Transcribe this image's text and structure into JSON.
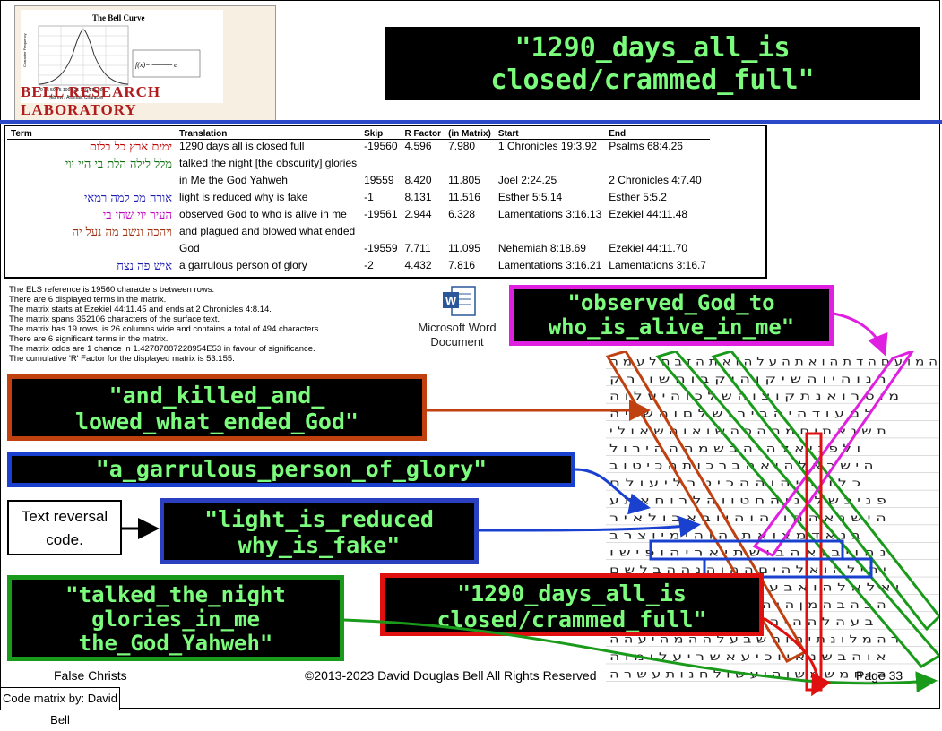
{
  "logo": {
    "chart_title": "The Bell Curve",
    "y_ticks": [
      "60",
      "50",
      "40",
      "30",
      "20",
      "10",
      "0"
    ],
    "x_ticks": "0  25  50  75  100  125  150  175  200",
    "x_label": "Hebrew / Aramaic Character",
    "y_label": "Character Frequency",
    "lab_name": "BELL RESEARCH LABORATORY"
  },
  "title": {
    "line1": "\"1290_days_all_is",
    "line2": "closed/crammed_full\""
  },
  "table": {
    "headers": [
      "Term",
      "Translation",
      "Skip",
      "R Factor",
      "(in Matrix)",
      "Start",
      "End"
    ],
    "rows": [
      {
        "term": "ימים ארץ כל בלום",
        "color": "#c00000",
        "translation": "1290 days all is closed full",
        "skip": "-19560",
        "r": "4.596",
        "m": "7.980",
        "start": "1 Chronicles 19:3.92",
        "end": "Psalms 68:4.26"
      },
      {
        "term": "מלל לילה הלת בי היי יוי",
        "color": "#107010",
        "translation": "talked the night [the obscurity] glories",
        "skip": "",
        "r": "",
        "m": "",
        "start": "",
        "end": ""
      },
      {
        "term": "",
        "color": "#000000",
        "translation": "in Me the God Yahweh",
        "skip": "19559",
        "r": "8.420",
        "m": "11.805",
        "start": "Joel 2:24.25",
        "end": "2 Chronicles 4:7.40"
      },
      {
        "term": "אורה מכ למה רמאי",
        "color": "#1a1ab0",
        "translation": "light is reduced why is fake",
        "skip": "-1",
        "r": "8.131",
        "m": "11.516",
        "start": "Esther 5:5.14",
        "end": "Esther 5:5.2"
      },
      {
        "term": "העיר יוי שחי בי",
        "color": "#c000c0",
        "translation": "observed God to who is alive in me",
        "skip": "-19561",
        "r": "2.944",
        "m": "6.328",
        "start": "Lamentations 3:16.13",
        "end": "Ezekiel 44:11.48"
      },
      {
        "term": "ויהכה ונשב מה נעל יה",
        "color": "#a03010",
        "translation": "and plagued and blowed what ended",
        "skip": "",
        "r": "",
        "m": "",
        "start": "",
        "end": ""
      },
      {
        "term": "",
        "color": "#000000",
        "translation": "God",
        "skip": "-19559",
        "r": "7.711",
        "m": "11.095",
        "start": "Nehemiah 8:18.69",
        "end": "Ezekiel 44:11.70"
      },
      {
        "term": "איש פה נצח",
        "color": "#1a1ab0",
        "translation": "a garrulous person of glory",
        "skip": "-2",
        "r": "4.432",
        "m": "7.816",
        "start": "Lamentations 3:16.21",
        "end": "Lamentations 3:16.7"
      }
    ]
  },
  "notes": [
    "The ELS reference is 19560 characters between rows.",
    "There are 6 displayed terms in the matrix.",
    "The matrix starts at Ezekiel 44:11.45 and ends at 2 Chronicles 4:8.14.",
    "The matrix spans 352106 characters of the surface text.",
    "The matrix has 19 rows, is 26 columns wide and contains a total of 494 characters.",
    "There are 6 significant terms in the matrix.",
    "The matrix odds are 1 chance in 1.42787887228954E53  in favour of significance.",
    "The cumulative 'R' Factor for the displayed matrix is 53.155."
  ],
  "word_doc": {
    "icon_letter": "W",
    "label": "Microsoft Word Document"
  },
  "labels": {
    "observed": {
      "text": "\"observed_God_to\nwho_is_alive_in_me\"",
      "color": "#e020e0"
    },
    "killed": {
      "text": "\"and_killed_and_\nlowed_what_ended_God\"",
      "color": "#c04010"
    },
    "garrulous": {
      "text": "\"a_garrulous_person_of_glory\"",
      "color": "#1a40d0"
    },
    "light": {
      "text": "\"light_is_reduced\nwhy_is_fake\"",
      "color": "#2a40c0"
    },
    "talked": {
      "text": "\"talked_the_night\nglories_in_me\nthe_God_Yahweh\"",
      "color": "#1a9a1a"
    },
    "days": {
      "text": "\"1290_days_all_is\nclosed/crammed_full\"",
      "color": "#e01010"
    }
  },
  "text_reversal": "Text reversal code.",
  "matrix_rows": [
    "ה מ ו ע ם ה ד ת ה ו א ת ה ע ל ה ו א ת ה ז ב ח ל ע מ ה",
    "ר נ ו ה י ו ה ש י ק ו ה י ק ב ו ה ש ו י ר ק",
    "מ ו ס ר ו א נ ת ק ו צ ו ה ש ל כ ו ה י ע ל ו ה",
    "ל ם ע ו ד ה י ה ב י ר ו ש ל ם ו ה ש ו י ה",
    "ת ש נ א ת י ם מ ה ה כ ה ש ו א ו ה ש א ו ל י",
    "ו ל פ נ י א ל ה י ה ב ש מ ה ה ה י ר ו ל",
    "ה י ש ר א ל ה ו א ה ב ר כ ו ת ה כ י ט ו ב",
    "כ ל ו י ה י ה ו ה ה כ י ט ב ל י ע ו ל ם",
    "פ נ י כ ש ל ו נ ו ה ח ט ו ו ה ל ר ו ח א ת ע",
    "ה י ש נ א ה ח ו י ה ו ה י ו ב א ב ו ל א י ר",
    "ב נ א ד מ צ ו א ת י ה ו ה י מ י ו צ ר ב",
    "נ ה ו י ב ו א ה ב ו ש ת י א ר י ה ו פ י ש ו",
    "י ת י ל ה ו א ל ה י ם ה ה ו ה נ ה ה ב ל ש ם",
    "י א ל א ל ה ו א ב ע ו ו ד ב ר י ה ו ה ב ר ו א",
    "ה כ ה ב ה מ ן ה ו ה ל ו ה ש א י ש ע ל ה י ה",
    "ב ע ה ל ה ה י ה ו ו ה ל י מ י ה ת ד ה ו ה",
    "ר ה מ ל ו נ ת י ה ו ה ש ב ע ל ה ה מ ה י ע ה ה",
    "א ו ה ב ש נ א י ו כ י ע א ש ר י ע ל ו מ ו ה",
    "ה ו ח מ ש מ ש ו ה י ע ש ו ל ח נ ו ת ע ש ר ה"
  ],
  "footer": {
    "left": "False Christs",
    "mid": "©2013-2023 David Douglas Bell All Rights Reserved",
    "right": "Page 33",
    "credit": "Code matrix by: David Bell"
  }
}
